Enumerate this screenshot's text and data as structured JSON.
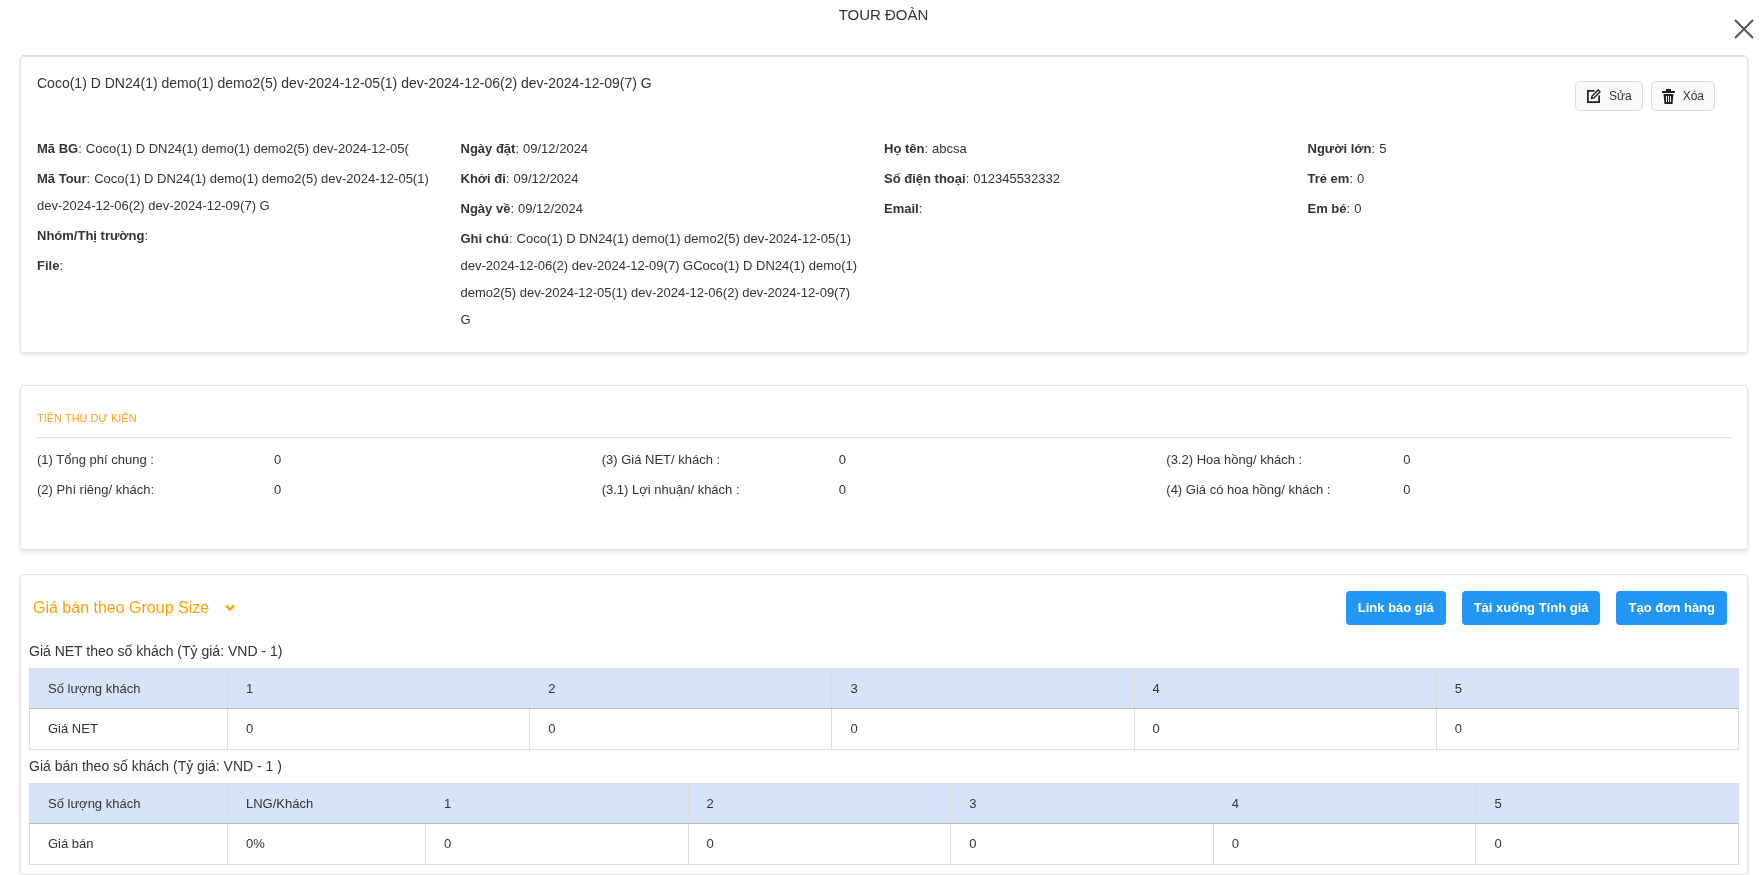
{
  "dialog": {
    "title": "TOUR ĐOÀN"
  },
  "tour_card": {
    "heading": "Coco(1) D DN24(1) demo(1) demo2(5) dev-2024-12-05(1) dev-2024-12-06(2) dev-2024-12-09(7) G",
    "actions": [
      {
        "kind": "edit",
        "label": "Sửa"
      },
      {
        "kind": "delete",
        "label": "Xóa"
      }
    ],
    "columns": [
      [
        {
          "label": "**Mã BG**:",
          "value": "Coco(1) D DN24(1) demo(1) demo2(5) dev-2024-12-05("
        },
        {
          "label": "**Mã Tour**:",
          "value": "Coco(1) D DN24(1) demo(1) demo2(5) dev-2024-12-05(1) dev-2024-12-06(2) dev-2024-12-09(7) G"
        },
        {
          "label": "**Nhóm/Thị trường**:"
        },
        {
          "label": "**File**:"
        }
      ],
      [
        {
          "label": "**Ngày đặt**:",
          "value": "09/12/2024"
        },
        {
          "label": "**Khởi đi**:",
          "value": "09/12/2024"
        },
        {
          "label": "**Ngày về**:",
          "value": "09/12/2024"
        },
        {
          "label": "**Ghi chú**:",
          "value": "Coco(1) D DN24(1) demo(1) demo2(5) dev-2024-12-05(1) dev-2024-12-06(2) dev-2024-12-09(7) GCoco(1) D DN24(1) demo(1) demo2(5) dev-2024-12-05(1) dev-2024-12-06(2) dev-2024-12-09(7) G"
        }
      ],
      [
        {
          "label": "**Họ tên**:",
          "value": "abcsa"
        },
        {
          "label": "**Số điện thoại**:",
          "value": "012345532332"
        },
        {
          "label": "**Email**:"
        }
      ],
      [
        {
          "label": "**Người lớn**:",
          "value": "5"
        },
        {
          "label": "**Trẻ em**:",
          "value": "0"
        },
        {
          "label": "**Em bé**:",
          "value": "0"
        }
      ]
    ]
  },
  "revenue": {
    "title": "TIỀN THU DỰ KIẾN",
    "columns": [
      [
        {
          "label": "(1) Tổng phí chung :",
          "value": "0"
        },
        {
          "label": "(2) Phí riêng/ khách:",
          "value": "0"
        }
      ],
      [
        {
          "label": "(3) Giá NET/ khách :",
          "value": "0"
        },
        {
          "label": "(3.1) Lợi nhuận/ khách :",
          "value": "0"
        }
      ],
      [
        {
          "label": "(3.2) Hoa hồng/ khách :",
          "value": "0"
        },
        {
          "label": "(4) Giá có hoa hồng/ khách :",
          "value": "0"
        }
      ]
    ]
  },
  "pricing": {
    "title": "Giá bán theo Group Size",
    "expanded": true,
    "buttons": [
      "Link báo giá",
      "Tải xuống Tính giá",
      "Tạo đơn hàng"
    ],
    "tables": [
      {
        "caption": "Giá NET theo số khách (Tỷ giá: VND - 1)",
        "columns": [
          "Số lượng khách",
          "1",
          "2",
          "3",
          "4",
          "5"
        ],
        "rows": [
          [
            "Giá NET",
            "0",
            "0",
            "0",
            "0",
            "0"
          ]
        ]
      },
      {
        "caption": "Giá bán theo số khách (Tỷ giá: VND - 1 )",
        "columns": [
          "Số lượng khách",
          "LNG/Khách",
          "1",
          "2",
          "3",
          "4",
          "5"
        ],
        "rows": [
          [
            "Giá bán",
            "0%",
            "0",
            "0",
            "0",
            "0",
            "0"
          ]
        ]
      }
    ]
  }
}
